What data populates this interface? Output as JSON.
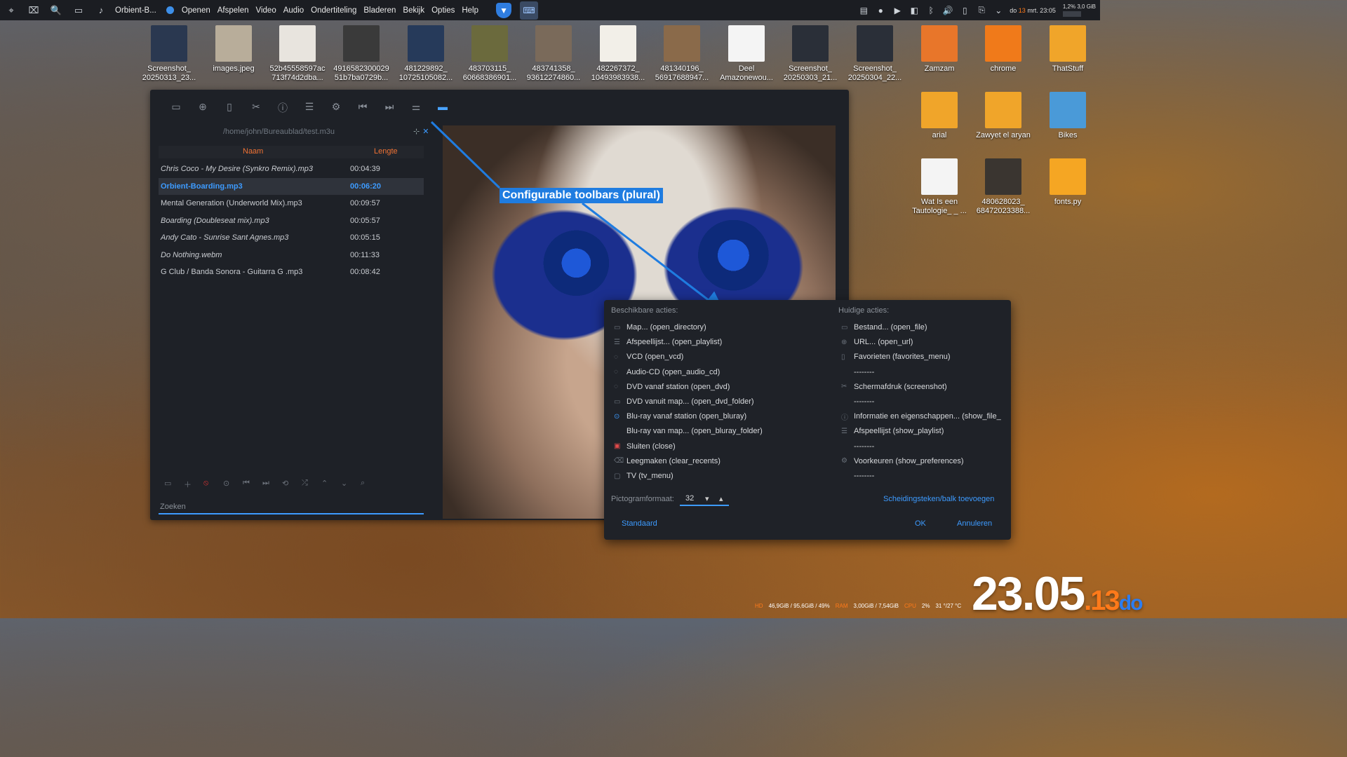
{
  "topbar": {
    "app_name": "Orbient-B...",
    "menu": [
      "Openen",
      "Afspelen",
      "Video",
      "Audio",
      "Ondertiteling",
      "Bladeren",
      "Bekijk",
      "Opties",
      "Help"
    ],
    "clock_prefix": "do",
    "clock_day": "13",
    "clock_rest": "mrt. 23:05",
    "cpu_usage": "1,2%",
    "memory": "3,0 GiB"
  },
  "desktop": {
    "icons": [
      {
        "line1": "Screenshot_",
        "line2": "20250313_23...",
        "color": "#2a3850"
      },
      {
        "line1": "images.jpeg",
        "line2": "",
        "color": "#b8ad9a"
      },
      {
        "line1": "52b45558597ac",
        "line2": "713f74d2dba...",
        "color": "#e8e4de"
      },
      {
        "line1": "4916582300029",
        "line2": "51b7ba0729b...",
        "color": "#3a3a3a"
      },
      {
        "line1": "481229892_",
        "line2": "10725105082...",
        "color": "#263a5a"
      },
      {
        "line1": "483703115_",
        "line2": "60668386901...",
        "color": "#6b6a3d"
      },
      {
        "line1": "483741358_",
        "line2": "93612274860...",
        "color": "#7a6a5a"
      },
      {
        "line1": "482267372_",
        "line2": "10493983938...",
        "color": "#f2efe8"
      },
      {
        "line1": "481340196_",
        "line2": "56917688947...",
        "color": "#8a6a4a"
      },
      {
        "line1": "Deel",
        "line2": "Amazonewou...",
        "color": "#f4f4f4"
      },
      {
        "line1": "Screenshot_",
        "line2": "20250303_21...",
        "color": "#2a2f38"
      },
      {
        "line1": "Screenshot_",
        "line2": "20250304_22...",
        "color": "#2a2f38"
      },
      {
        "line1": "Zamzam",
        "line2": "",
        "color": "#e8762a"
      },
      {
        "line1": "chrome",
        "line2": "",
        "color": "#f07a1a"
      },
      {
        "line1": "ThatStuff",
        "line2": "",
        "color": "#f0a52a"
      },
      {
        "line1": "arial",
        "line2": "",
        "color": "#f0a52a"
      },
      {
        "line1": "Zawyet el aryan",
        "line2": "",
        "color": "#f0a52a"
      },
      {
        "line1": "Bikes",
        "line2": "",
        "color": "#4a9ad8"
      },
      {
        "line1": "Wat Is een",
        "line2": "Tautologie_ _ ...",
        "color": "#f4f4f4"
      },
      {
        "line1": "480628023_",
        "line2": "68472023388...",
        "color": "#3a3530"
      },
      {
        "line1": "fonts.py",
        "line2": "",
        "color": "#f5a623"
      }
    ]
  },
  "player": {
    "playlist_path": "/home/john/Bureaublad/test.m3u",
    "col_name": "Naam",
    "col_length": "Lengte",
    "rows": [
      {
        "name": "Chris Coco - My Desire (Synkro Remix).mp3",
        "length": "00:04:39"
      },
      {
        "name": "Orbient-Boarding.mp3",
        "length": "00:06:20"
      },
      {
        "name": "Mental Generation (Underworld Mix).mp3",
        "length": "00:09:57"
      },
      {
        "name": "Boarding (Doubleseat mix).mp3",
        "length": "00:05:57"
      },
      {
        "name": "Andy Cato - Sunrise Sant Agnes.mp3",
        "length": "00:05:15"
      },
      {
        "name": "Do Nothing.webm",
        "length": "00:11:33"
      },
      {
        "name": "G Club / Banda Sonora - Guitarra G .mp3",
        "length": "00:08:42"
      }
    ],
    "search_placeholder": "Zoeken"
  },
  "annotation": "Configurable toolbars (plural)",
  "dialog": {
    "available_label": "Beschikbare acties:",
    "current_label": "Huidige acties:",
    "available": [
      "Map... (open_directory)",
      "Afspeellijst... (open_playlist)",
      "VCD (open_vcd)",
      "Audio-CD (open_audio_cd)",
      "DVD vanaf station (open_dvd)",
      "DVD vanuit map... (open_dvd_folder)",
      "Blu-ray vanaf station (open_bluray)",
      "Blu-ray van map... (open_bluray_folder)",
      "Sluiten (close)",
      "Leegmaken (clear_recents)",
      "TV (tv_menu)"
    ],
    "current": [
      "Bestand... (open_file)",
      "URL... (open_url)",
      "Favorieten (favorites_menu)",
      "--------",
      "Schermafdruk (screenshot)",
      "--------",
      "Informatie en eigenschappen... (show_file_",
      "Afspeellijst (show_playlist)",
      "--------",
      "Voorkeuren (show_preferences)",
      "--------"
    ],
    "icon_size_label": "Pictogramformaat:",
    "icon_size_value": "32",
    "add_separator": "Scheidingsteken/balk toevoegen",
    "standard": "Standaard",
    "ok": "OK",
    "cancel": "Annuleren"
  },
  "widget": {
    "date_big": "23.05",
    "date_orange": ".13",
    "date_blue": "do",
    "hd_label": "HD",
    "hd_value": "46,9GiB / 95,6GiB / 49%",
    "ram_label": "RAM",
    "ram_value": "3,00GiB / 7,54GiB",
    "cpu_label": "CPU",
    "cpu_value": "2%",
    "temp": "31 °/27 °C"
  }
}
